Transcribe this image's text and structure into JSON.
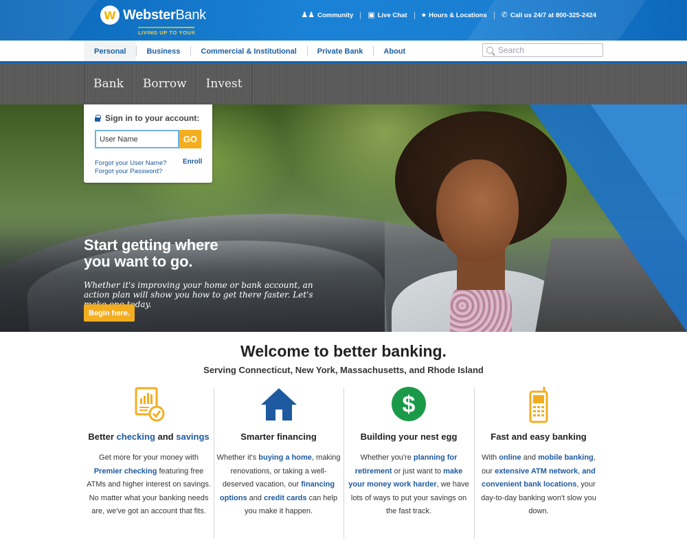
{
  "brand": {
    "name_bold": "Webster",
    "name_light": "Bank",
    "tagline": "LIVING UP TO YOU®",
    "logo_glyph": "W",
    "colors": {
      "primary_blue": "#1a7fd3",
      "accent_gold": "#f4ad1f",
      "link_blue": "#1d5aa0",
      "green": "#1a9a48"
    }
  },
  "utility_nav": [
    {
      "label": "Community",
      "icon": "people-icon"
    },
    {
      "label": "Live Chat",
      "icon": "chat-icon"
    },
    {
      "label": "Hours & Locations",
      "icon": "location-pin-icon"
    },
    {
      "label": "Call us 24/7 at 800-325-2424",
      "icon": "phone-icon"
    }
  ],
  "main_nav": {
    "items": [
      "Personal",
      "Business",
      "Commercial & Institutional",
      "Private Bank",
      "About"
    ],
    "active": "Personal",
    "search_placeholder": "Search"
  },
  "sub_nav": {
    "items": [
      "Bank",
      "Borrow",
      "Invest"
    ]
  },
  "login": {
    "title": "Sign in to your account:",
    "username_placeholder": "User Name",
    "go_label": "GO",
    "forgot_username": "Forgot your User Name?",
    "forgot_password": "Forgot your Password?",
    "enroll": "Enroll"
  },
  "hero": {
    "headline_line1": "Start getting where",
    "headline_line2": "you want to go.",
    "subtext": "Whether it's improving your home or bank account, an action plan will show you how to get there faster. Let's make one today.",
    "cta": "Begin here."
  },
  "welcome": {
    "title": "Welcome to better banking.",
    "subtitle": "Serving Connecticut, New York, Massachusetts, and Rhode Island"
  },
  "features": [
    {
      "icon": "checklist-document-icon",
      "title_prefix": "Better ",
      "title_link1": "checking",
      "title_mid": " and ",
      "title_link2": "savings",
      "text_a": "Get more for your money with",
      "text_link1": "Premier checking",
      "text_b": " featuring free ATMs and higher interest on savings. No matter what your banking needs are, we've got an account that fits."
    },
    {
      "icon": "house-icon",
      "title": "Smarter financing",
      "text_a": "Whether it's ",
      "text_link1": "buying a home",
      "text_b": ", making renovations, or taking a well-deserved vacation, our ",
      "text_link2": "financing options",
      "text_c": " and ",
      "text_link3": "credit cards",
      "text_d": " can help you make it happen."
    },
    {
      "icon": "dollar-circle-icon",
      "title": "Building your nest egg",
      "text_a": "Whether you're ",
      "text_link1": "planning for retirement",
      "text_b": " or just want to ",
      "text_link2": "make your money work harder",
      "text_c": ", we have lots of ways to put your savings on the fast track."
    },
    {
      "icon": "mobile-phone-icon",
      "title": "Fast and easy banking",
      "text_a": "With ",
      "text_link1": "online",
      "text_b": " and ",
      "text_link2": "mobile banking",
      "text_c": ", our ",
      "text_link3": "extensive ATM network",
      "text_d": ", ",
      "text_link4": "and convenient bank locations",
      "text_e": ", your day-to-day banking won't slow you down."
    }
  ]
}
